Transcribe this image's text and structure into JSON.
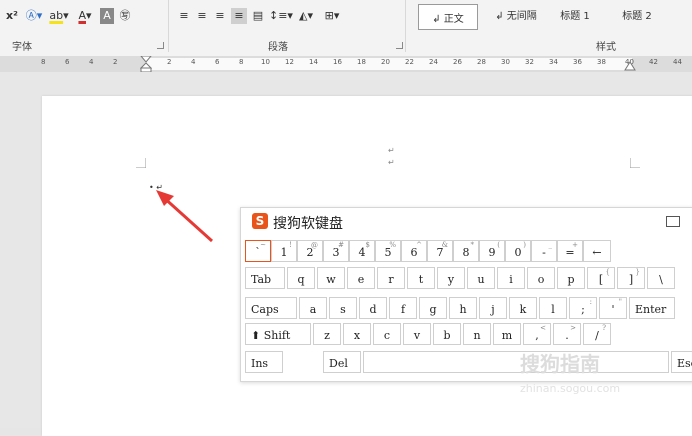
{
  "ribbon": {
    "groups": [
      "字体",
      "段落",
      "样式"
    ],
    "styles": [
      "↲ 正文",
      "↲ 无间隔",
      "标题 1",
      "标题 2"
    ]
  },
  "ruler": {
    "ticks": [
      "8",
      "6",
      "4",
      "2",
      "2",
      "4",
      "6",
      "8",
      "10",
      "12",
      "14",
      "16",
      "18",
      "20",
      "22",
      "24",
      "26",
      "28",
      "30",
      "32",
      "34",
      "36",
      "38",
      "40",
      "42",
      "44"
    ]
  },
  "document": {
    "marks": [
      "↵",
      "↵",
      "• ↵"
    ]
  },
  "keyboard": {
    "title": "搜狗软键盘",
    "logo": "S",
    "rows": [
      [
        {
          "m": "`",
          "s": "~"
        },
        {
          "m": "1",
          "s": "!"
        },
        {
          "m": "2",
          "s": "@"
        },
        {
          "m": "3",
          "s": "#"
        },
        {
          "m": "4",
          "s": "$"
        },
        {
          "m": "5",
          "s": "%"
        },
        {
          "m": "6",
          "s": "^"
        },
        {
          "m": "7",
          "s": "&"
        },
        {
          "m": "8",
          "s": "*"
        },
        {
          "m": "9",
          "s": "("
        },
        {
          "m": "0",
          "s": ")"
        },
        {
          "m": "-",
          "s": "_"
        },
        {
          "m": "=",
          "s": "+"
        },
        {
          "m": "←",
          "s": ""
        }
      ],
      [
        {
          "m": "Tab",
          "s": ""
        },
        {
          "m": "q",
          "s": ""
        },
        {
          "m": "w",
          "s": ""
        },
        {
          "m": "e",
          "s": ""
        },
        {
          "m": "r",
          "s": ""
        },
        {
          "m": "t",
          "s": ""
        },
        {
          "m": "y",
          "s": ""
        },
        {
          "m": "u",
          "s": ""
        },
        {
          "m": "i",
          "s": ""
        },
        {
          "m": "o",
          "s": ""
        },
        {
          "m": "p",
          "s": ""
        },
        {
          "m": "[",
          "s": "{"
        },
        {
          "m": "]",
          "s": "}"
        },
        {
          "m": "\\",
          "s": ""
        }
      ],
      [
        {
          "m": "Caps",
          "s": ""
        },
        {
          "m": "a",
          "s": ""
        },
        {
          "m": "s",
          "s": ""
        },
        {
          "m": "d",
          "s": ""
        },
        {
          "m": "f",
          "s": ""
        },
        {
          "m": "g",
          "s": ""
        },
        {
          "m": "h",
          "s": ""
        },
        {
          "m": "j",
          "s": ""
        },
        {
          "m": "k",
          "s": ""
        },
        {
          "m": "l",
          "s": ""
        },
        {
          "m": ";",
          "s": ":"
        },
        {
          "m": "'",
          "s": "\""
        },
        {
          "m": "Enter",
          "s": ""
        }
      ],
      [
        {
          "m": "⬆ Shift",
          "s": ""
        },
        {
          "m": "z",
          "s": ""
        },
        {
          "m": "x",
          "s": ""
        },
        {
          "m": "c",
          "s": ""
        },
        {
          "m": "v",
          "s": ""
        },
        {
          "m": "b",
          "s": ""
        },
        {
          "m": "n",
          "s": ""
        },
        {
          "m": "m",
          "s": ""
        },
        {
          "m": ",",
          "s": "<"
        },
        {
          "m": ".",
          "s": ">"
        },
        {
          "m": "/",
          "s": "?"
        }
      ],
      [
        {
          "m": "Ins",
          "s": ""
        },
        {
          "m": "Del",
          "s": ""
        },
        {
          "m": "",
          "s": ""
        },
        {
          "m": "Esc",
          "s": ""
        }
      ]
    ]
  },
  "watermark": {
    "line1": "搜狗指南",
    "line2": "zhinan.sogou.com"
  },
  "colors": {
    "accent": "#e8541a",
    "arrow": "#e53935"
  }
}
